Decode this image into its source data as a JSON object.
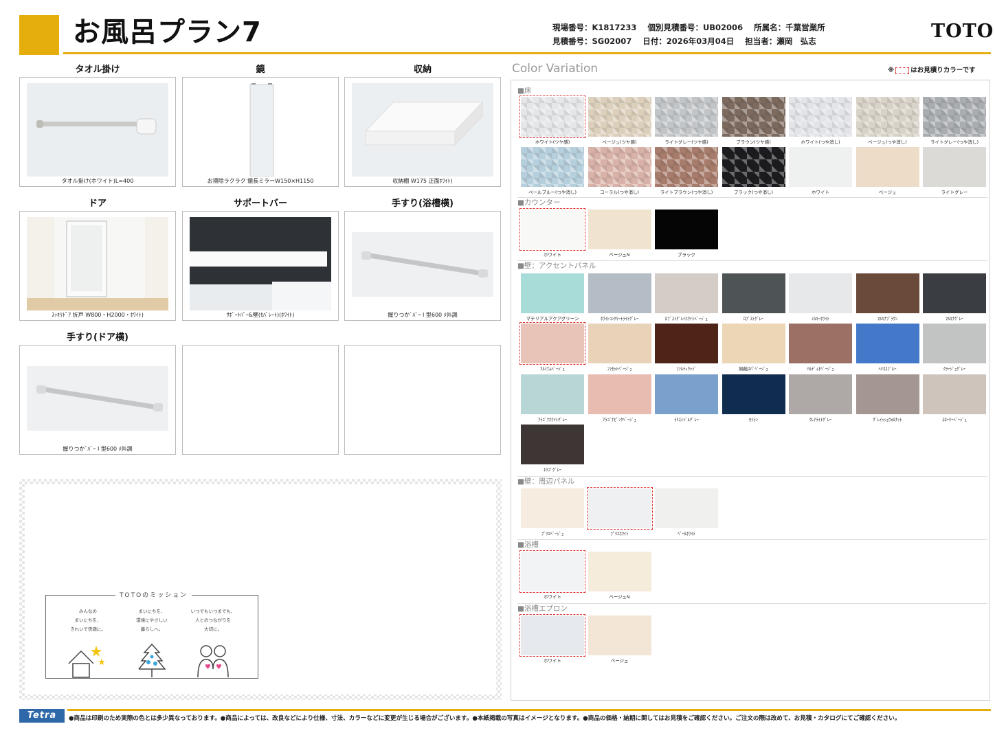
{
  "header": {
    "title": "お風呂プラン7",
    "site_no": "現場番号：K1817233",
    "estimate_indiv": "個別見積番号：UB02006",
    "office": "所属名：千葉営業所",
    "estimate_no": "見積番号：SG02007",
    "date": "日付：2026年03月04日",
    "staff": "担当者：瀬岡　弘志",
    "brand": "TOTO"
  },
  "products": [
    {
      "title": "タオル掛け",
      "label": "タオル掛け(ホワイト)L=400",
      "icon": "towel-bar-icon"
    },
    {
      "title": "鏡",
      "label": "お掃除ラクラク 鏡長ミラーW150×H1150",
      "icon": "mirror-icon"
    },
    {
      "title": "収納",
      "label": "収納棚 W175 正面ﾎﾜｲﾄ)",
      "icon": "shelf-icon"
    },
    {
      "title": "ドア",
      "label": "ｽｯｷﾘﾄﾞｱ 折戸 W800・H2000・ﾎﾜｲﾄ)",
      "icon": "door-icon"
    },
    {
      "title": "サポートバー",
      "label": "ｻﾎﾟｰﾄﾊﾞｰ&壁(ｾﾊﾟﾚｰﾄ)(ﾎﾜｲﾄ)",
      "icon": "support-bar-icon"
    },
    {
      "title": "手すり(浴槽横)",
      "label": "握りつかﾞﾊﾞｰ I 型600 ﾒﾀﾙ調",
      "icon": "grab-bar-icon"
    },
    {
      "title": "手すり(ドア横)",
      "label": "握りつかﾞﾊﾞｰ I 型600 ﾒﾀﾙ調",
      "icon": "grab-bar-icon"
    },
    {
      "title": "",
      "label": "",
      "icon": ""
    },
    {
      "title": "",
      "label": "",
      "icon": ""
    }
  ],
  "mission": {
    "title": "TOTOのミッション",
    "items": [
      "みんなの\nまいにちを、\nきれいで快適に。",
      "まいにちを、\n環境にやさしい\n暮らしへ。",
      "いつでもいつまでも、\n人とのつながりを\n大切に。"
    ]
  },
  "color_variation": {
    "title": "Color Variation",
    "note_prefix": "※",
    "note_suffix": "はお見積りカラーです",
    "sections": [
      {
        "name": "■床",
        "swatches": [
          {
            "name": "ホワイト(ツヤ感)",
            "color": "#e4e6e8",
            "selected": true
          },
          {
            "name": "ベージュ(ツヤ感)",
            "color": "#dcd0bc",
            "selected": false
          },
          {
            "name": "ライトグレー(ツヤ感)",
            "color": "#c2c5c8",
            "selected": false
          },
          {
            "name": "ブラウン(ツヤ感)",
            "color": "#7d6a5e",
            "selected": false
          },
          {
            "name": "ホワイト(つや消し)",
            "color": "#e2e4e8",
            "selected": false
          },
          {
            "name": "ベージュ(つや消し)",
            "color": "#d8d2c8",
            "selected": false
          },
          {
            "name": "ライトグレー(つや消し)",
            "color": "#a9acb0",
            "selected": false
          },
          {
            "name": "ペールブルー(つや消し)",
            "color": "#b6cfdc",
            "selected": false
          },
          {
            "name": "コーラル(つや消し)",
            "color": "#d8b2a8",
            "selected": false
          },
          {
            "name": "ライトブラウン(つや消し)",
            "color": "#a77c6c",
            "selected": false
          },
          {
            "name": "ブラック(つや消し)",
            "color": "#1c1c20",
            "selected": false
          },
          {
            "name": "ホワイト",
            "color": "#eff0f0",
            "selected": false
          },
          {
            "name": "ベージュ",
            "color": "#ecdcc8",
            "selected": false
          },
          {
            "name": "ライトグレー",
            "color": "#dcdad6",
            "selected": false
          }
        ]
      },
      {
        "name": "■カウンター",
        "swatches": [
          {
            "name": "ホワイト",
            "color": "#f8f8f6",
            "selected": true
          },
          {
            "name": "ベージュN",
            "color": "#f0e4d0",
            "selected": false
          },
          {
            "name": "ブラック",
            "color": "#050505",
            "selected": false
          }
        ]
      },
      {
        "name": "■壁：アクセントパネル",
        "swatches": [
          {
            "name": "マテリアルアクアグリーン",
            "color": "#a8dcd8",
            "selected": false
          },
          {
            "name": "ﾎﾜｲﾄｺﾝｸﾘｰﾄﾗｲﾄｸﾞﾚｰ",
            "color": "#b4bcc6",
            "selected": false
          },
          {
            "name": "ﾛﾌﾞｽﾄｸﾞﾚｲﾎﾜｲﾄﾍﾞｰｼﾞｭ",
            "color": "#d4ccc6",
            "selected": false
          },
          {
            "name": "ﾛﾌﾞｽﾄｸﾞﾚｰ",
            "color": "#4e5456",
            "selected": false
          },
          {
            "name": "ﾐﾙｷｰﾎﾜｲﾄ",
            "color": "#e6e8ea",
            "selected": false
          },
          {
            "name": "ﾏﾙｷﾅﾌﾞﾗｳﾝ",
            "color": "#6a4a3a",
            "selected": false
          },
          {
            "name": "ﾏﾙｷﾅｸﾞﾚｰ",
            "color": "#3a3e42",
            "selected": false
          },
          {
            "name": "ｱﾙﾐﾅﾑﾍﾞｰｼﾞｭ",
            "color": "#e8c4b8",
            "selected": true
          },
          {
            "name": "ﾌｧｾｯﾄﾍﾞｰｼﾞｭ",
            "color": "#e8d2b8",
            "selected": false
          },
          {
            "name": "ﾌｧﾙﾃｨｳｯﾄﾞ",
            "color": "#4e2418",
            "selected": false
          },
          {
            "name": "絹絵ｽﾊﾟﾍﾞｰｼﾞｭ",
            "color": "#ecd6b6",
            "selected": false
          },
          {
            "name": "ﾊﾙﾃﾞｨｵﾍﾞｰｼﾞｭ",
            "color": "#9c7064",
            "selected": false
          },
          {
            "name": "ﾍﾘｵｽﾌﾞﾙｰ",
            "color": "#4478c8",
            "selected": false
          },
          {
            "name": "ｸﾗｰｼﾞｭｸﾞﾚｰ",
            "color": "#c2c4c4",
            "selected": false
          },
          {
            "name": "ｱﾗｺﾞﾅﾎﾜｲﾄｸﾞﾚｰ",
            "color": "#b8d6d6",
            "selected": false
          },
          {
            "name": "ｱﾗｺﾞﾅﾋﾟﾝｸﾍﾞｰｼﾞｭ",
            "color": "#e8bcb0",
            "selected": false
          },
          {
            "name": "ﾗﾘｽﾐﾄﾞﾙｸﾞﾚｰ",
            "color": "#7aa0cc",
            "selected": false
          },
          {
            "name": "ｾｲﾗﾝ",
            "color": "#102c4e",
            "selected": false
          },
          {
            "name": "ｸﾚｱﾗｲﾄｸﾞﾚｰ",
            "color": "#aea8a6",
            "selected": false
          },
          {
            "name": "ｸﾞﾚｲｯｼｭｳｫﾙﾅｯﾄ",
            "color": "#a49690",
            "selected": false
          },
          {
            "name": "ｽﾛｰﾘｰﾍﾞｰｼﾞｭ",
            "color": "#cec4bc",
            "selected": false
          },
          {
            "name": "ｷﾘｺﾞｸﾞﾚｰ",
            "color": "#3e3634",
            "selected": false
          }
        ]
      },
      {
        "name": "■壁：周辺パネル",
        "swatches": [
          {
            "name": "ﾌﾟﾘｴﾍﾞｰｼﾞｭ",
            "color": "#f6ece0",
            "selected": false
          },
          {
            "name": "ﾌﾟﾘｴﾎﾜｲﾄ",
            "color": "#eef0f2",
            "selected": true
          },
          {
            "name": "ﾍﾟｰﾙﾎﾜｲﾄ",
            "color": "#f0f0ee",
            "selected": false
          }
        ]
      },
      {
        "name": "■浴槽",
        "swatches": [
          {
            "name": "ホワイト",
            "color": "#f2f3f4",
            "selected": true
          },
          {
            "name": "ベージュN",
            "color": "#f6ecdc",
            "selected": false
          }
        ]
      },
      {
        "name": "■浴槽エプロン",
        "swatches": [
          {
            "name": "ホワイト",
            "color": "#e6eaee",
            "selected": true
          },
          {
            "name": "ベージュ",
            "color": "#f4e6d6",
            "selected": false
          }
        ]
      }
    ]
  },
  "footer": {
    "logo": "Tetra",
    "text": "●商品は印刷のため実際の色とは多少異なっております。●商品によっては、改良などにより仕様、寸法、カラーなどに変更が生じる場合がございます。●本紙掲載の写真はイメージとなります。●商品の価格・納期に関してはお見積をご確認ください。ご注文の際は改めて、お見積・カタログにてご確認ください。"
  },
  "colors": {
    "accent": "#e5ae0d",
    "selection": "#e03030",
    "footer_logo": "#2f68a8"
  }
}
